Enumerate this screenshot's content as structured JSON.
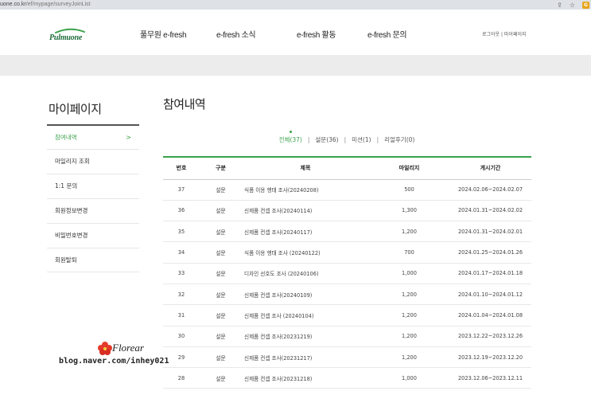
{
  "browser": {
    "url_host": "uone.co.kr",
    "url_path": "/ef/mypage/surveyJoinList",
    "share_icon": "share-icon",
    "star_icon": "star-icon",
    "ext_icon": "extension-icon"
  },
  "header": {
    "logo_text": "Pulmuone",
    "nav": [
      "풀무원 e-fresh",
      "e-fresh 소식",
      "e-fresh 활동",
      "e-fresh 문의"
    ],
    "util": "로그아웃 | 마이페이지"
  },
  "sidebar": {
    "title": "마이페이지",
    "items": [
      {
        "label": "참여내역",
        "active": true
      },
      {
        "label": "마일리지 조회"
      },
      {
        "label": "1:1 문의"
      },
      {
        "label": "회원정보변경"
      },
      {
        "label": "비밀번호변경"
      },
      {
        "label": "회원탈퇴"
      }
    ]
  },
  "main": {
    "title": "참여내역",
    "filters": [
      "전체(37)",
      "설문(36)",
      "미션(1)",
      "리얼후기(0)"
    ],
    "columns": [
      "번호",
      "구분",
      "제목",
      "마일리지",
      "게시기간"
    ],
    "rows": [
      {
        "no": "37",
        "type": "설문",
        "title": "식품 이용 행태 조사(20240208)",
        "mileage": "500",
        "period": "2024.02.06~2024.02.07"
      },
      {
        "no": "36",
        "type": "설문",
        "title": "신제품 컨셉 조사(20240114)",
        "mileage": "1,300",
        "period": "2024.01.31~2024.02.02"
      },
      {
        "no": "35",
        "type": "설문",
        "title": "신제품 컨셉 조사(20240117)",
        "mileage": "1,200",
        "period": "2024.01.31~2024.02.01"
      },
      {
        "no": "34",
        "type": "설문",
        "title": "식품 이용 행태 조사 (20240122)",
        "mileage": "700",
        "period": "2024.01.25~2024.01.26"
      },
      {
        "no": "33",
        "type": "설문",
        "title": "디자인 선호도 조사 (20240106)",
        "mileage": "1,000",
        "period": "2024.01.17~2024.01.18"
      },
      {
        "no": "32",
        "type": "설문",
        "title": "신제품 컨셉 조사(20240109)",
        "mileage": "1,200",
        "period": "2024.01.10~2024.01.12"
      },
      {
        "no": "31",
        "type": "설문",
        "title": "신제품 컨셉 조사 (20240104)",
        "mileage": "1,200",
        "period": "2024.01.04~2024.01.08"
      },
      {
        "no": "30",
        "type": "설문",
        "title": "신제품 컨셉 조사(20231219)",
        "mileage": "1,200",
        "period": "2023.12.22~2023.12.26"
      },
      {
        "no": "29",
        "type": "설문",
        "title": "신제품 컨셉 조사(20231217)",
        "mileage": "1,200",
        "period": "2023.12.19~2023.12.20"
      },
      {
        "no": "28",
        "type": "설문",
        "title": "신제품 컨셉 조사(20231218)",
        "mileage": "1,000",
        "period": "2023.12.06~2023.12.11"
      },
      {
        "no": "",
        "type": "",
        "title": "",
        "mileage": "",
        "period": ""
      }
    ]
  },
  "watermark": {
    "brand": "Florear",
    "url": "blog.naver.com/inhey021"
  },
  "colors": {
    "accent": "#3aa24a",
    "band": "#ececec",
    "logo": "#1f6b3a"
  }
}
